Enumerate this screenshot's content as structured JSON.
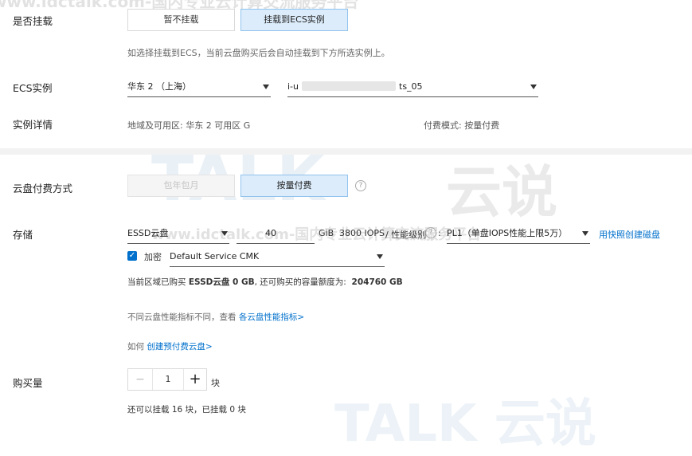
{
  "mount": {
    "label": "是否挂载",
    "options": [
      "暂不挂载",
      "挂载到ECS实例"
    ],
    "hint": "如选择挂载到ECS，当前云盘购买后会自动挂载到下方所选实例上。"
  },
  "ecs_instance": {
    "label": "ECS实例",
    "region_value": "华东 2 （上海）",
    "instance_prefix": "i-u",
    "instance_suffix": "ts_05"
  },
  "instance_detail": {
    "label": "实例详情",
    "zone": "地域及可用区:  华东 2 可用区 G",
    "billing": "付费模式:  按量付费"
  },
  "billing": {
    "label": "云盘付费方式",
    "options": [
      "包年包月",
      "按量付费"
    ],
    "help_icon": "question-circle-icon"
  },
  "storage": {
    "label": "存储",
    "disk_type": "ESSD云盘",
    "size": "40",
    "size_unit": "GiB",
    "iops": "3800 IOPS",
    "perf_label": "性能级别",
    "perf_value": "PL1（单盘IOPS性能上限5万）",
    "snapshot_link": "用快照创建磁盘",
    "encrypt_label": "加密",
    "encrypt_checked": true,
    "kms_value": "Default Service CMK",
    "purchased_prefix": "当前区域已购买",
    "purchased_strong": "ESSD云盘 0 GB",
    "purchased_mid": ", 还可购买的容量额度为:",
    "quota": "204760 GB",
    "perf_note_prefix": "不同云盘性能指标不同，查看",
    "perf_note_link": "各云盘性能指标>",
    "prepaid_prefix": "如何",
    "prepaid_link": "创建预付费云盘>"
  },
  "quantity": {
    "label": "购买量",
    "minus": "−",
    "value": "1",
    "plus": "+",
    "unit": "块",
    "note": "还可以挂载 16 块，已挂载 0 块"
  },
  "watermark": {
    "top_text": "www.idctalk.com-国内专业云计算交流服务平台",
    "mid_text": "www.idctalk.com-国内专业云计算交流服务平台",
    "brand": "TALK",
    "brand_cn": "云说"
  },
  "colors": {
    "accent": "#0070cc",
    "active_bg": "#dcecfb",
    "divider": "#f2f2f2"
  }
}
